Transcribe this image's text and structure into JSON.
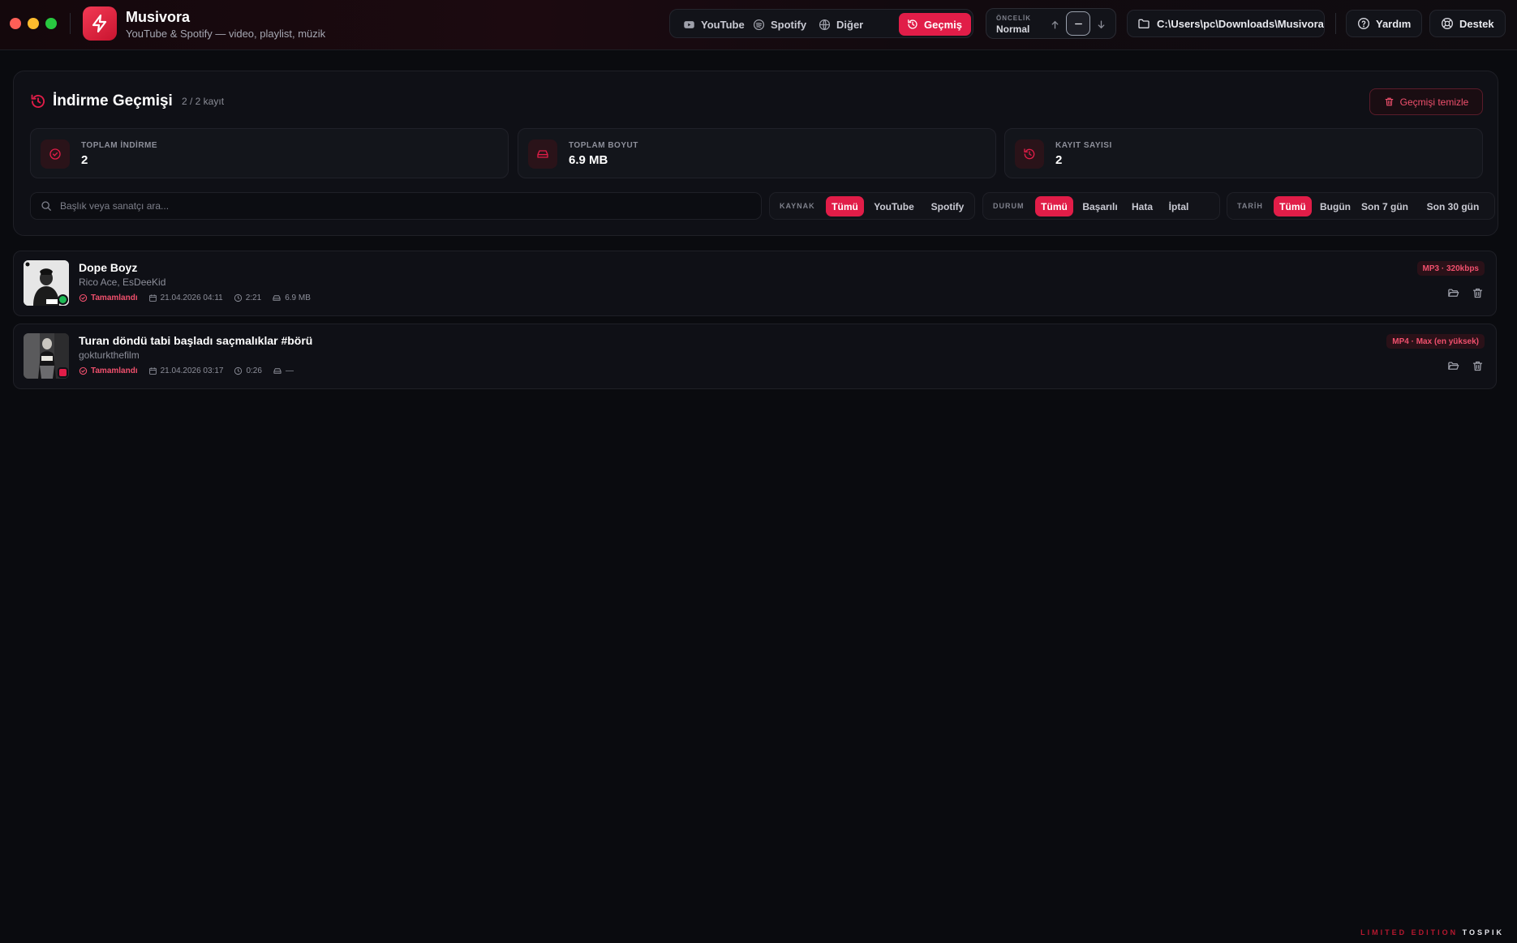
{
  "app": {
    "title": "Musivora",
    "subtitle": "YouTube & Spotify — video, playlist, müzik"
  },
  "nav": {
    "youtube": "YouTube",
    "spotify": "Spotify",
    "other": "Diğer",
    "history": "Geçmiş"
  },
  "priority": {
    "label": "ÖNCELİK",
    "value": "Normal"
  },
  "download_path": "C:\\Users\\pc\\Downloads\\Musivora",
  "header_buttons": {
    "help": "Yardım",
    "support": "Destek"
  },
  "history_panel": {
    "title": "İndirme Geçmişi",
    "count": "2 / 2 kayıt",
    "clear_button": "Geçmişi temizle"
  },
  "stats": [
    {
      "label": "TOPLAM İNDİRME",
      "value": "2",
      "icon": "check-circle-icon"
    },
    {
      "label": "TOPLAM BOYUT",
      "value": "6.9 MB",
      "icon": "drive-icon"
    },
    {
      "label": "KAYIT SAYISI",
      "value": "2",
      "icon": "history-icon"
    }
  ],
  "search": {
    "placeholder": "Başlık veya sanatçı ara..."
  },
  "filters": {
    "source": {
      "label": "KAYNAK",
      "options": [
        "Tümü",
        "YouTube",
        "Spotify"
      ],
      "selected": "Tümü"
    },
    "status": {
      "label": "DURUM",
      "options": [
        "Tümü",
        "Başarılı",
        "Hata",
        "İptal"
      ],
      "selected": "Tümü"
    },
    "date": {
      "label": "TARİH",
      "options": [
        "Tümü",
        "Bugün",
        "Son 7 gün",
        "Son 30 gün"
      ],
      "selected": "Tümü"
    }
  },
  "history_items": [
    {
      "title": "Dope Boyz",
      "artist": "Rico Ace, EsDeeKid",
      "status": "Tamamlandı",
      "date": "21.04.2026 04:11",
      "duration": "2:21",
      "size": "6.9 MB",
      "format": "MP3 · 320kbps",
      "source": "spotify",
      "source_color": "#1db954"
    },
    {
      "title": "Turan döndü tabi başladı saçmalıklar #börü",
      "artist": "gokturkthefilm",
      "status": "Tamamlandı",
      "date": "21.04.2026 03:17",
      "duration": "0:26",
      "size": "—",
      "format": "MP4 · Max (en yüksek)",
      "source": "youtube",
      "source_color": "#e11d48"
    }
  ],
  "footer": {
    "edition": "LIMITED EDITION",
    "brand": "TOSPIK"
  },
  "colors": {
    "accent": "#e11d48",
    "background": "#0a0b0f",
    "panel": "#0f1016"
  }
}
